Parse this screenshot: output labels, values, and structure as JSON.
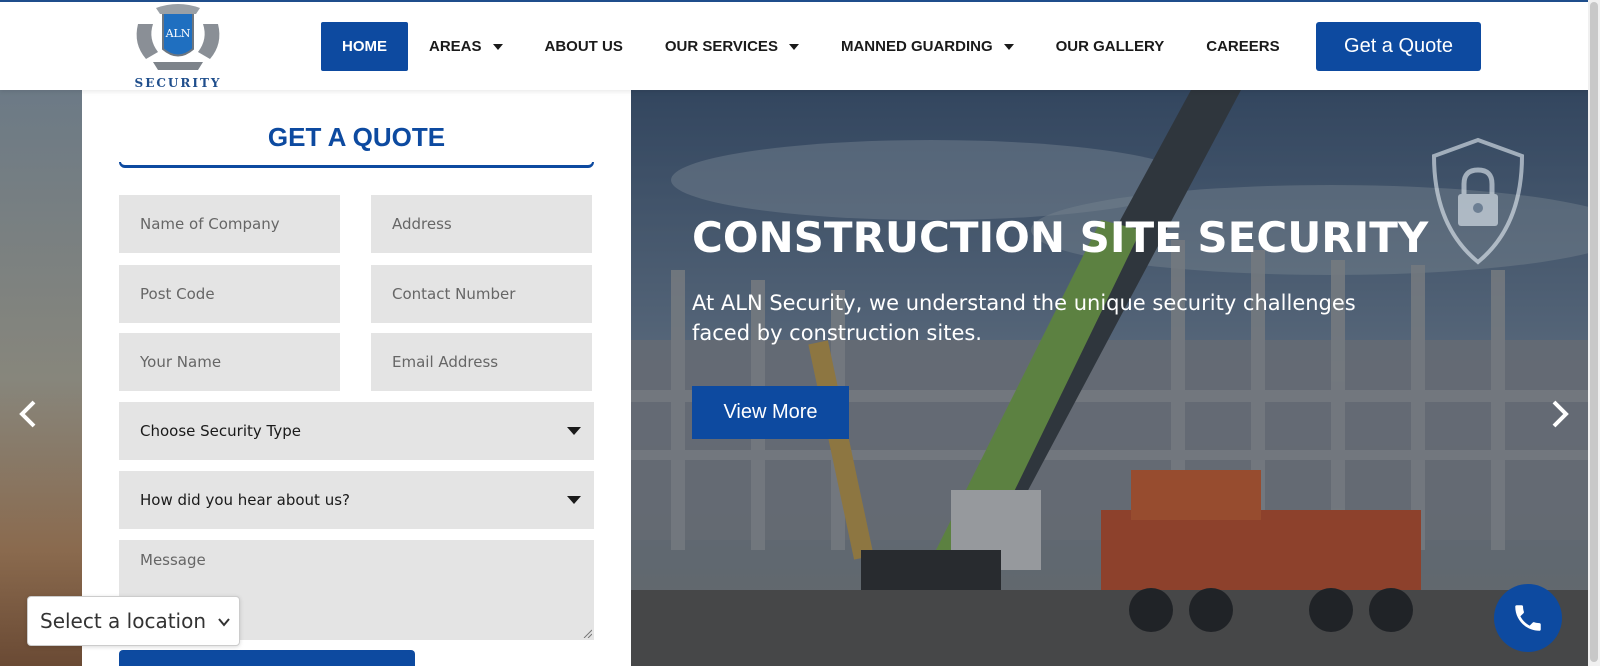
{
  "logo": {
    "emblem_text": "ALN",
    "word": "SECURITY"
  },
  "nav": {
    "items": [
      {
        "label": "HOME",
        "active": true,
        "dropdown": false
      },
      {
        "label": "AREAS",
        "active": false,
        "dropdown": true
      },
      {
        "label": "ABOUT US",
        "active": false,
        "dropdown": false
      },
      {
        "label": "OUR SERVICES",
        "active": false,
        "dropdown": true
      },
      {
        "label": "MANNED GUARDING",
        "active": false,
        "dropdown": true
      },
      {
        "label": "OUR GALLERY",
        "active": false,
        "dropdown": false
      },
      {
        "label": "CAREERS",
        "active": false,
        "dropdown": false
      }
    ],
    "cta_label": "Get a Quote"
  },
  "form": {
    "title": "GET A QUOTE",
    "company_placeholder": "Name of Company",
    "address_placeholder": "Address",
    "postcode_placeholder": "Post Code",
    "contact_placeholder": "Contact Number",
    "name_placeholder": "Your Name",
    "email_placeholder": "Email Address",
    "security_type_value": "Choose Security Type",
    "heard_value": "How did you hear about us?",
    "message_placeholder": "Message"
  },
  "slide": {
    "title": "CONSTRUCTION SITE SECURITY",
    "description": "At ALN Security, we understand the unique security challenges faced by construction sites.",
    "button_label": "View More"
  },
  "location_select": {
    "value": "Select a location"
  },
  "colors": {
    "brand_blue": "#0d4aa0",
    "field_gray": "#e4e4e4"
  },
  "icons": [
    "chevron-left-icon",
    "chevron-right-icon",
    "shield-lock-icon",
    "phone-icon",
    "chevron-down-icon"
  ]
}
